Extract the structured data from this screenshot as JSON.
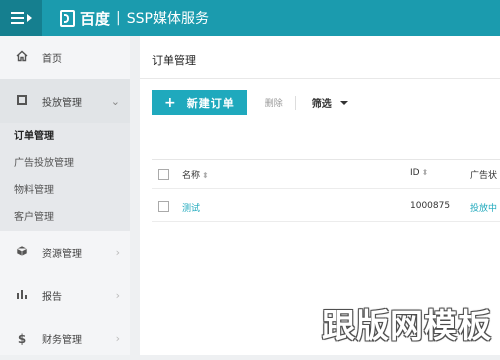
{
  "header": {
    "brand_name": "百度",
    "brand_separator": "|",
    "brand_sub": "SSP媒体服务",
    "accent": "#1b9bae"
  },
  "sidebar": {
    "items": [
      {
        "label": "首页",
        "icon": "home-icon"
      },
      {
        "label": "投放管理",
        "icon": "square-icon",
        "expanded": true
      },
      {
        "label": "资源管理",
        "icon": "cube-icon"
      },
      {
        "label": "报告",
        "icon": "bar-chart-icon"
      },
      {
        "label": "财务管理",
        "icon": "dollar-icon"
      }
    ],
    "subitems": [
      {
        "label": "订单管理",
        "active": true
      },
      {
        "label": "广告投放管理"
      },
      {
        "label": "物料管理"
      },
      {
        "label": "客户管理"
      }
    ]
  },
  "main": {
    "title": "订单管理",
    "new_button": "新建订单",
    "new_button_icon": "+",
    "delete_button": "删除",
    "filter_button": "筛选",
    "button_color": "#1fa9bd",
    "table": {
      "columns": [
        "名称",
        "ID",
        "广告状"
      ],
      "rows": [
        {
          "name": "测试",
          "id": "1000875",
          "status": "投放中"
        }
      ]
    }
  },
  "watermark": "跟版网模板"
}
